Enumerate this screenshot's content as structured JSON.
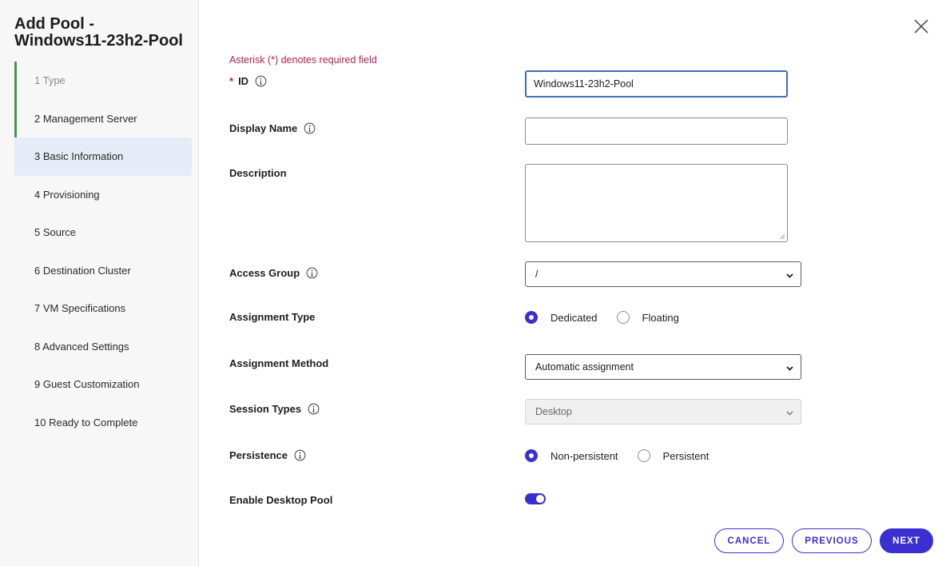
{
  "wizard": {
    "title": "Add Pool - Windows11-23h2-Pool",
    "steps": [
      {
        "label": "1 Type"
      },
      {
        "label": "2 Management Server"
      },
      {
        "label": "3 Basic Information"
      },
      {
        "label": "4 Provisioning"
      },
      {
        "label": "5 Source"
      },
      {
        "label": "6 Destination Cluster"
      },
      {
        "label": "7 VM Specifications"
      },
      {
        "label": "8 Advanced Settings"
      },
      {
        "label": "9 Guest Customization"
      },
      {
        "label": "10 Ready to Complete"
      }
    ]
  },
  "form": {
    "required_note": "Asterisk (*) denotes required field",
    "id": {
      "star": "*",
      "label": "ID",
      "value": "Windows11-23h2-Pool"
    },
    "display_name": {
      "label": "Display Name",
      "value": ""
    },
    "description": {
      "label": "Description",
      "value": ""
    },
    "access_group": {
      "label": "Access Group",
      "value": "/"
    },
    "assignment_type": {
      "label": "Assignment Type",
      "options": [
        "Dedicated",
        "Floating"
      ],
      "selected": "Dedicated"
    },
    "assignment_method": {
      "label": "Assignment Method",
      "value": "Automatic assignment"
    },
    "session_types": {
      "label": "Session Types",
      "value": "Desktop"
    },
    "persistence": {
      "label": "Persistence",
      "options": [
        "Non-persistent",
        "Persistent"
      ],
      "selected": "Non-persistent"
    },
    "enable_desktop_pool": {
      "label": "Enable Desktop Pool",
      "enabled": true
    }
  },
  "buttons": {
    "cancel": "CANCEL",
    "previous": "PREVIOUS",
    "next": "NEXT"
  },
  "colors": {
    "accent": "#3b2fd1",
    "required": "#b1234f",
    "completed_step": "#3f9a4a",
    "current_step_bg": "#e5ecf7"
  }
}
